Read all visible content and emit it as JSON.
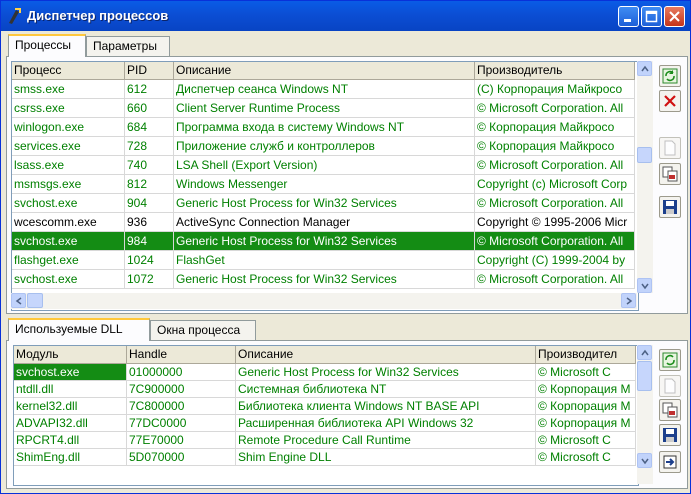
{
  "window": {
    "title": "Диспетчер процессов"
  },
  "tabs_top": [
    {
      "label": "Процессы"
    },
    {
      "label": "Параметры"
    }
  ],
  "process_list": {
    "columns": [
      "Процесс",
      "PID",
      "Описание",
      "Производитель"
    ],
    "rows": [
      [
        "smss.exe",
        "612",
        "Диспетчер сеанса  Windows NT",
        "(C) Корпорация Майкросо"
      ],
      [
        "csrss.exe",
        "660",
        "Client Server Runtime Process",
        "© Microsoft Corporation. All"
      ],
      [
        "winlogon.exe",
        "684",
        "Программа входа в систему Windows NT",
        "© Корпорация Майкросо"
      ],
      [
        "services.exe",
        "728",
        "Приложение служб и контроллеров",
        "© Корпорация Майкросо"
      ],
      [
        "lsass.exe",
        "740",
        "LSA Shell (Export Version)",
        "© Microsoft Corporation. All"
      ],
      [
        "msmsgs.exe",
        "812",
        "Windows Messenger",
        "Copyright (c) Microsoft Corp"
      ],
      [
        "svchost.exe",
        "904",
        "Generic Host Process for Win32 Services",
        "© Microsoft Corporation. All"
      ],
      [
        "wcescomm.exe",
        "936",
        "ActiveSync Connection Manager",
        "Copyright © 1995-2006 Micr"
      ],
      [
        "svchost.exe",
        "984",
        "Generic Host Process for Win32 Services",
        "© Microsoft Corporation. All"
      ],
      [
        "flashget.exe",
        "1024",
        "FlashGet",
        "Copyright (C) 1999-2004 by"
      ],
      [
        "svchost.exe",
        "1072",
        "Generic Host Process for Win32 Services",
        "© Microsoft Corporation. All"
      ]
    ]
  },
  "tabs_bottom": [
    {
      "label": "Используемые DLL"
    },
    {
      "label": "Окна процесса"
    }
  ],
  "dll_list": {
    "columns": [
      "Модуль",
      "Handle",
      "Описание",
      "Производител"
    ],
    "rows": [
      [
        "svchost.exe",
        "01000000",
        "Generic Host Process for Win32 Services",
        "© Microsoft C"
      ],
      [
        "ntdll.dll",
        "7C900000",
        "Системная библиотека NT",
        "© Корпорация М"
      ],
      [
        "kernel32.dll",
        "7C800000",
        "Библиотека клиента Windows NT BASE API",
        "© Корпорация М"
      ],
      [
        "ADVAPI32.dll",
        "77DC0000",
        "Расширенная библиотека API Windows 32",
        "© Корпорация М"
      ],
      [
        "RPCRT4.dll",
        "77E70000",
        "Remote Procedure Call Runtime",
        "© Microsoft C"
      ],
      [
        "ShimEng.dll",
        "5D070000",
        "Shim Engine DLL",
        "© Microsoft C"
      ]
    ]
  },
  "colors": {
    "title_bar": "#0b4ed4",
    "selection": "#148c14",
    "row_text": "#008000"
  }
}
